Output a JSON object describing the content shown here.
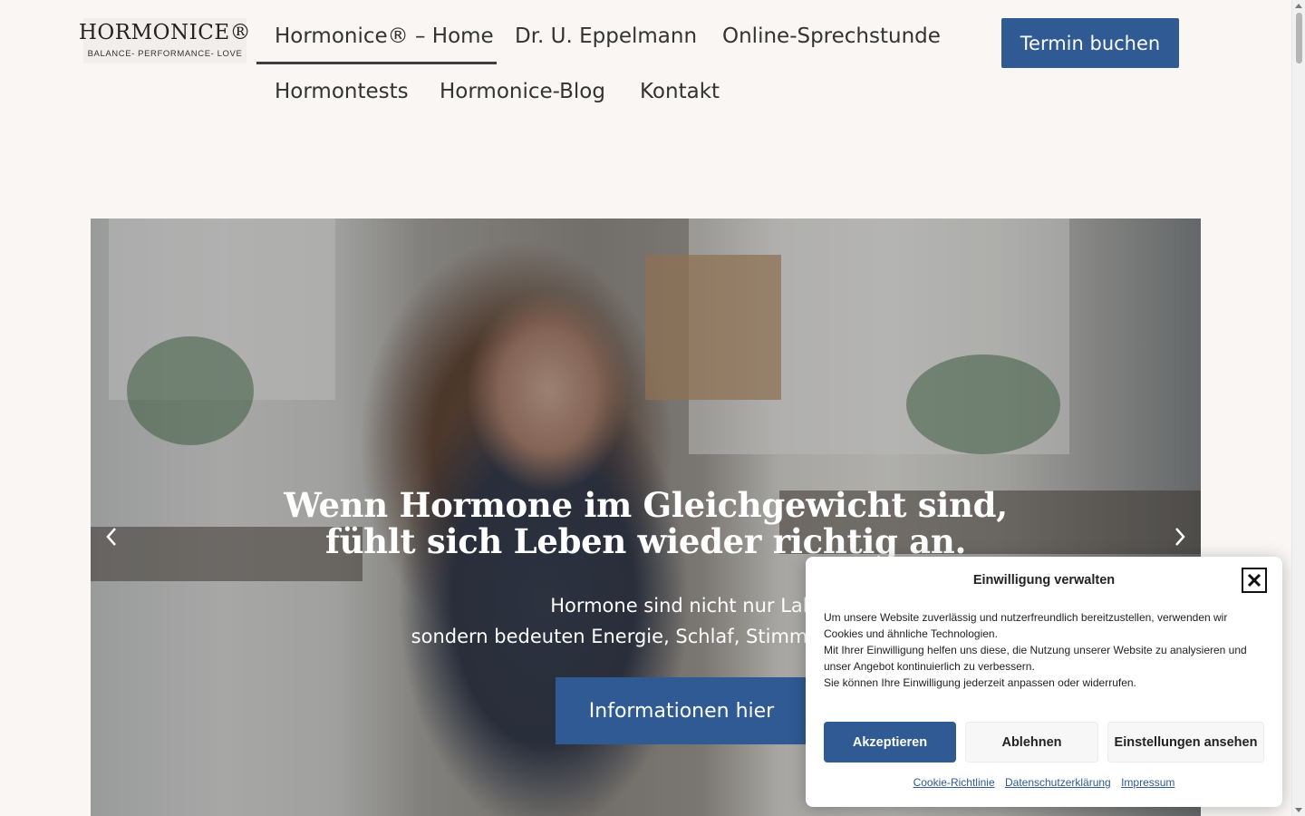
{
  "header": {
    "logo": {
      "name": "HORMONICE®",
      "tagline": "BALANCE- PERFORMANCE- LOVE"
    },
    "nav": [
      {
        "label": "Hormonice® – Home",
        "active": true
      },
      {
        "label": "Dr. U. Eppelmann"
      },
      {
        "label": "Online-Sprechstunde"
      },
      {
        "label": "Hormontests"
      },
      {
        "label": "Hormonice-Blog"
      },
      {
        "label": "Kontakt"
      }
    ],
    "cta_label": "Termin buchen"
  },
  "hero": {
    "title_line1": "Wenn Hormone im Gleichgewicht sind,",
    "title_line2": "fühlt sich Leben wieder richtig an.",
    "subtitle_line1": "Hormone sind nicht nur Laborw",
    "subtitle_line2": "sondern bedeuten Energie, Schlaf, Stimmung",
    "button_label": "Informationen hier",
    "prev_icon": "chevron-left-icon",
    "next_icon": "chevron-right-icon"
  },
  "cookie_dialog": {
    "title": "Einwilligung verwalten",
    "text_line1": "Um unsere Website zuverlässig und nutzerfreundlich bereitzustellen, verwenden wir Cookies und ähnliche Technologien.",
    "text_line2": "Mit Ihrer Einwilligung helfen uns diese, die Nutzung unserer Website zu analysieren und unser Angebot kontinuierlich zu verbessern.",
    "text_line3": "Sie können Ihre Einwilligung jederzeit anpassen oder widerrufen.",
    "accept_label": "Akzeptieren",
    "deny_label": "Ablehnen",
    "settings_label": "Einstellungen ansehen",
    "links": [
      "Cookie-Richtlinie",
      "Datenschutzerklärung",
      "Impressum"
    ]
  },
  "colors": {
    "accent": "#2f5a94",
    "background": "#f9f6f3",
    "text": "#333333"
  }
}
